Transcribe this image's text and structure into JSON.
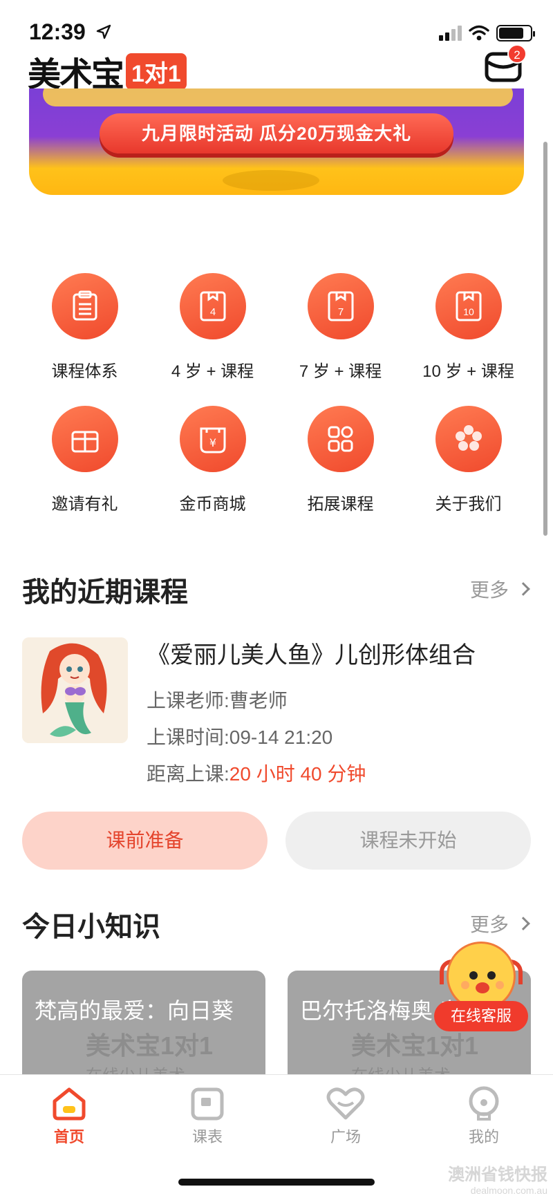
{
  "status_bar": {
    "time": "12:39"
  },
  "header": {
    "logo_text": "美术宝",
    "logo_badge": "1对1",
    "mail_count": "2"
  },
  "banner": {
    "pill_text": "九月限时活动 瓜分20万现金大礼"
  },
  "grid": [
    {
      "label": "课程体系",
      "icon": "clipboard-icon"
    },
    {
      "label": "4 岁 + 课程",
      "icon": "book-4-icon",
      "num": "4"
    },
    {
      "label": "7 岁 + 课程",
      "icon": "book-7-icon",
      "num": "7"
    },
    {
      "label": "10 岁 + 课程",
      "icon": "book-10-icon",
      "num": "10"
    },
    {
      "label": "邀请有礼",
      "icon": "gift-icon"
    },
    {
      "label": "金币商城",
      "icon": "coin-bag-icon"
    },
    {
      "label": "拓展课程",
      "icon": "apps-grid-icon"
    },
    {
      "label": "关于我们",
      "icon": "flower-icon"
    }
  ],
  "recent": {
    "title": "我的近期课程",
    "more": "更多",
    "course": {
      "name": "《爱丽儿美人鱼》儿创形体组合",
      "teacher": "上课老师:曹老师",
      "time": "上课时间:09-14 21:20",
      "countdown_label": "距离上课:",
      "countdown_value": "20 小时 40 分钟"
    },
    "btn_prep": "课前准备",
    "btn_status": "课程未开始"
  },
  "knowledge": {
    "title": "今日小知识",
    "more": "更多",
    "cards": [
      {
        "title": "梵高的最爱：向日葵",
        "wm": "美术宝1对1",
        "wm2": "在线少儿美术"
      },
      {
        "title": "巴尔托洛梅奥 奥尼",
        "wm": "美术宝1对1",
        "wm2": "在线少儿美术"
      }
    ]
  },
  "service": {
    "label": "在线客服"
  },
  "tabs": [
    {
      "label": "首页",
      "active": true
    },
    {
      "label": "课表",
      "active": false
    },
    {
      "label": "广场",
      "active": false
    },
    {
      "label": "我的",
      "active": false
    }
  ],
  "watermark": {
    "line1": "澳洲省钱快报",
    "line2": "dealmoon.com.au"
  },
  "colors": {
    "accent": "#f04a2d",
    "prep_bg": "#fdd3c9",
    "muted": "#999999"
  }
}
